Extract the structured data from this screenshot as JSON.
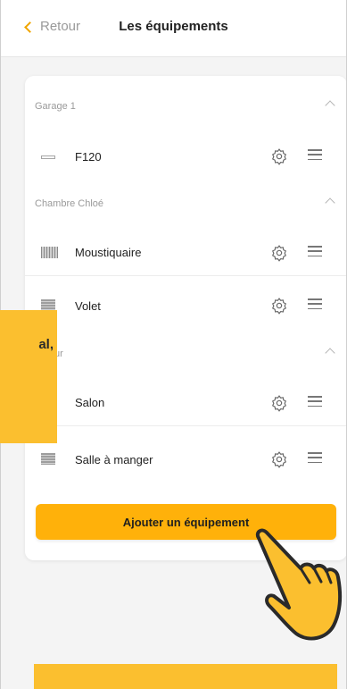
{
  "header": {
    "back_label": "Retour",
    "title": "Les équipements"
  },
  "groups": [
    {
      "name": "Garage 1",
      "items": [
        {
          "label": "F120",
          "icon": "thin-device-icon"
        }
      ]
    },
    {
      "name": "Chambre Chloé",
      "items": [
        {
          "label": "Moustiquaire",
          "icon": "mosquito-net-icon"
        },
        {
          "label": "Volet",
          "icon": "shutter-icon"
        }
      ]
    },
    {
      "name": "Séjour",
      "items": [
        {
          "label": "Salon",
          "icon": "shutter-icon"
        },
        {
          "label": "Salle à manger",
          "icon": "shutter-icon"
        }
      ]
    }
  ],
  "add_button_label": "Ajouter un équipement",
  "overlay": {
    "tooltip_text": "al,"
  },
  "colors": {
    "accent": "#ffb10a",
    "overlay_yellow": "#fbbf2f"
  }
}
